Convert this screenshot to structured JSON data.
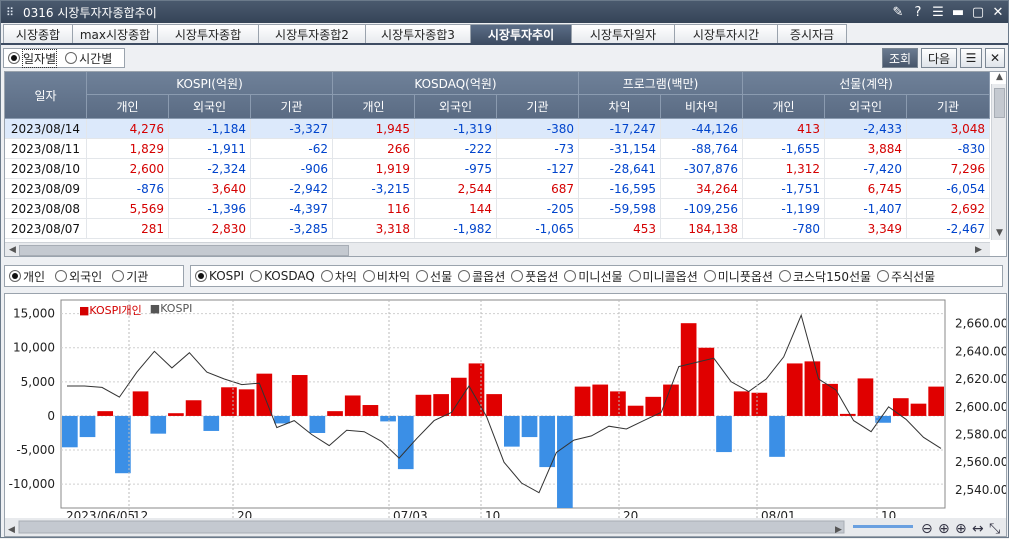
{
  "title": {
    "code": "0316",
    "name": "시장투자자종합추이"
  },
  "tabs": [
    {
      "label": "시장종합",
      "w": 70
    },
    {
      "label": "max시장종합",
      "w": 86
    },
    {
      "label": "시장투자종합",
      "w": 102
    },
    {
      "label": "시장투자종합2",
      "w": 108
    },
    {
      "label": "시장투자종합3",
      "w": 106
    },
    {
      "label": "시장투자추이",
      "w": 102,
      "active": true
    },
    {
      "label": "시장투자일자",
      "w": 104
    },
    {
      "label": "시장투자시간",
      "w": 104
    },
    {
      "label": "증시자금",
      "w": 70
    }
  ],
  "toolbar": {
    "radio_daily": "일자별",
    "radio_time": "시간별",
    "btn_query": "조회",
    "btn_next": "다음"
  },
  "grid": {
    "date_header": "일자",
    "groups": [
      "KOSPI(억원)",
      "KOSDAQ(억원)",
      "프로그램(백만)",
      "선물(계약)"
    ],
    "subheaders": [
      "개인",
      "외국인",
      "기관",
      "개인",
      "외국인",
      "기관",
      "차익",
      "비차익",
      "개인",
      "외국인",
      "기관"
    ],
    "rows": [
      {
        "date": "2023/08/14",
        "v": [
          "4,276",
          "-1,184",
          "-3,327",
          "1,945",
          "-1,319",
          "-380",
          "-17,247",
          "-44,126",
          "413",
          "-2,433",
          "3,048"
        ]
      },
      {
        "date": "2023/08/11",
        "v": [
          "1,829",
          "-1,911",
          "-62",
          "266",
          "-222",
          "-73",
          "-31,154",
          "-88,764",
          "-1,655",
          "3,884",
          "-830"
        ]
      },
      {
        "date": "2023/08/10",
        "v": [
          "2,600",
          "-2,324",
          "-906",
          "1,919",
          "-975",
          "-127",
          "-28,641",
          "-307,876",
          "1,312",
          "-7,420",
          "7,296"
        ]
      },
      {
        "date": "2023/08/09",
        "v": [
          "-876",
          "3,640",
          "-2,942",
          "-3,215",
          "2,544",
          "687",
          "-16,595",
          "34,264",
          "-1,751",
          "6,745",
          "-6,054"
        ]
      },
      {
        "date": "2023/08/08",
        "v": [
          "5,569",
          "-1,396",
          "-4,397",
          "116",
          "144",
          "-205",
          "-59,598",
          "-109,256",
          "-1,199",
          "-1,407",
          "2,692"
        ]
      },
      {
        "date": "2023/08/07",
        "v": [
          "281",
          "2,830",
          "-3,285",
          "3,318",
          "-1,982",
          "-1,065",
          "453",
          "184,138",
          "-780",
          "3,349",
          "-2,467"
        ]
      }
    ]
  },
  "options": {
    "investor": [
      "개인",
      "외국인",
      "기관"
    ],
    "market": [
      "KOSPI",
      "KOSDAQ",
      "차익",
      "비차익",
      "선물",
      "콜옵션",
      "풋옵션",
      "미니선물",
      "미니콜옵션",
      "미니풋옵션",
      "코스닥150선물",
      "주식선물"
    ]
  },
  "chart_data": {
    "type": "bar",
    "legend": [
      "KOSPI개인",
      "KOSPI"
    ],
    "left_ticks": [
      "15,000",
      "10,000",
      "5,000",
      "0",
      "-5,000",
      "-10,000"
    ],
    "right_ticks": [
      "2,660.00",
      "2,640.00",
      "2,620.00",
      "2,600.00",
      "2,580.00",
      "2,560.00",
      "2,540.00"
    ],
    "x_labels": [
      "2023/06/05",
      "12",
      "20",
      "07/03",
      "10",
      "20",
      "08/01",
      "10"
    ],
    "ylim": [
      -13500,
      17000
    ],
    "y2lim": [
      2527,
      2677
    ],
    "bars": [
      -4600,
      -3100,
      700,
      -8400,
      3600,
      -2600,
      400,
      2300,
      -2200,
      4200,
      3900,
      6200,
      -1100,
      6000,
      -2500,
      700,
      3000,
      1600,
      -800,
      -7800,
      3100,
      3200,
      5600,
      7700,
      3200,
      -4500,
      -3100,
      -7500,
      -13500,
      4300,
      4600,
      3600,
      1500,
      2800,
      4600,
      13600,
      10000,
      -5300,
      3600,
      3400,
      -6000,
      7700,
      8000,
      4700,
      300,
      5500,
      -1000,
      2600,
      1800,
      4300
    ],
    "line": [
      2615,
      2615,
      2614,
      2607,
      2625,
      2640,
      2628,
      2639,
      2625,
      2620,
      2616,
      2617,
      2585,
      2590,
      2580,
      2572,
      2583,
      2582,
      2575,
      2563,
      2577,
      2590,
      2596,
      2615,
      2593,
      2560,
      2545,
      2538,
      2567,
      2576,
      2579,
      2586,
      2584,
      2590,
      2596,
      2629,
      2632,
      2635,
      2618,
      2611,
      2620,
      2636,
      2666,
      2620,
      2612,
      2590,
      2582,
      2600,
      2591,
      2578,
      2570
    ]
  }
}
